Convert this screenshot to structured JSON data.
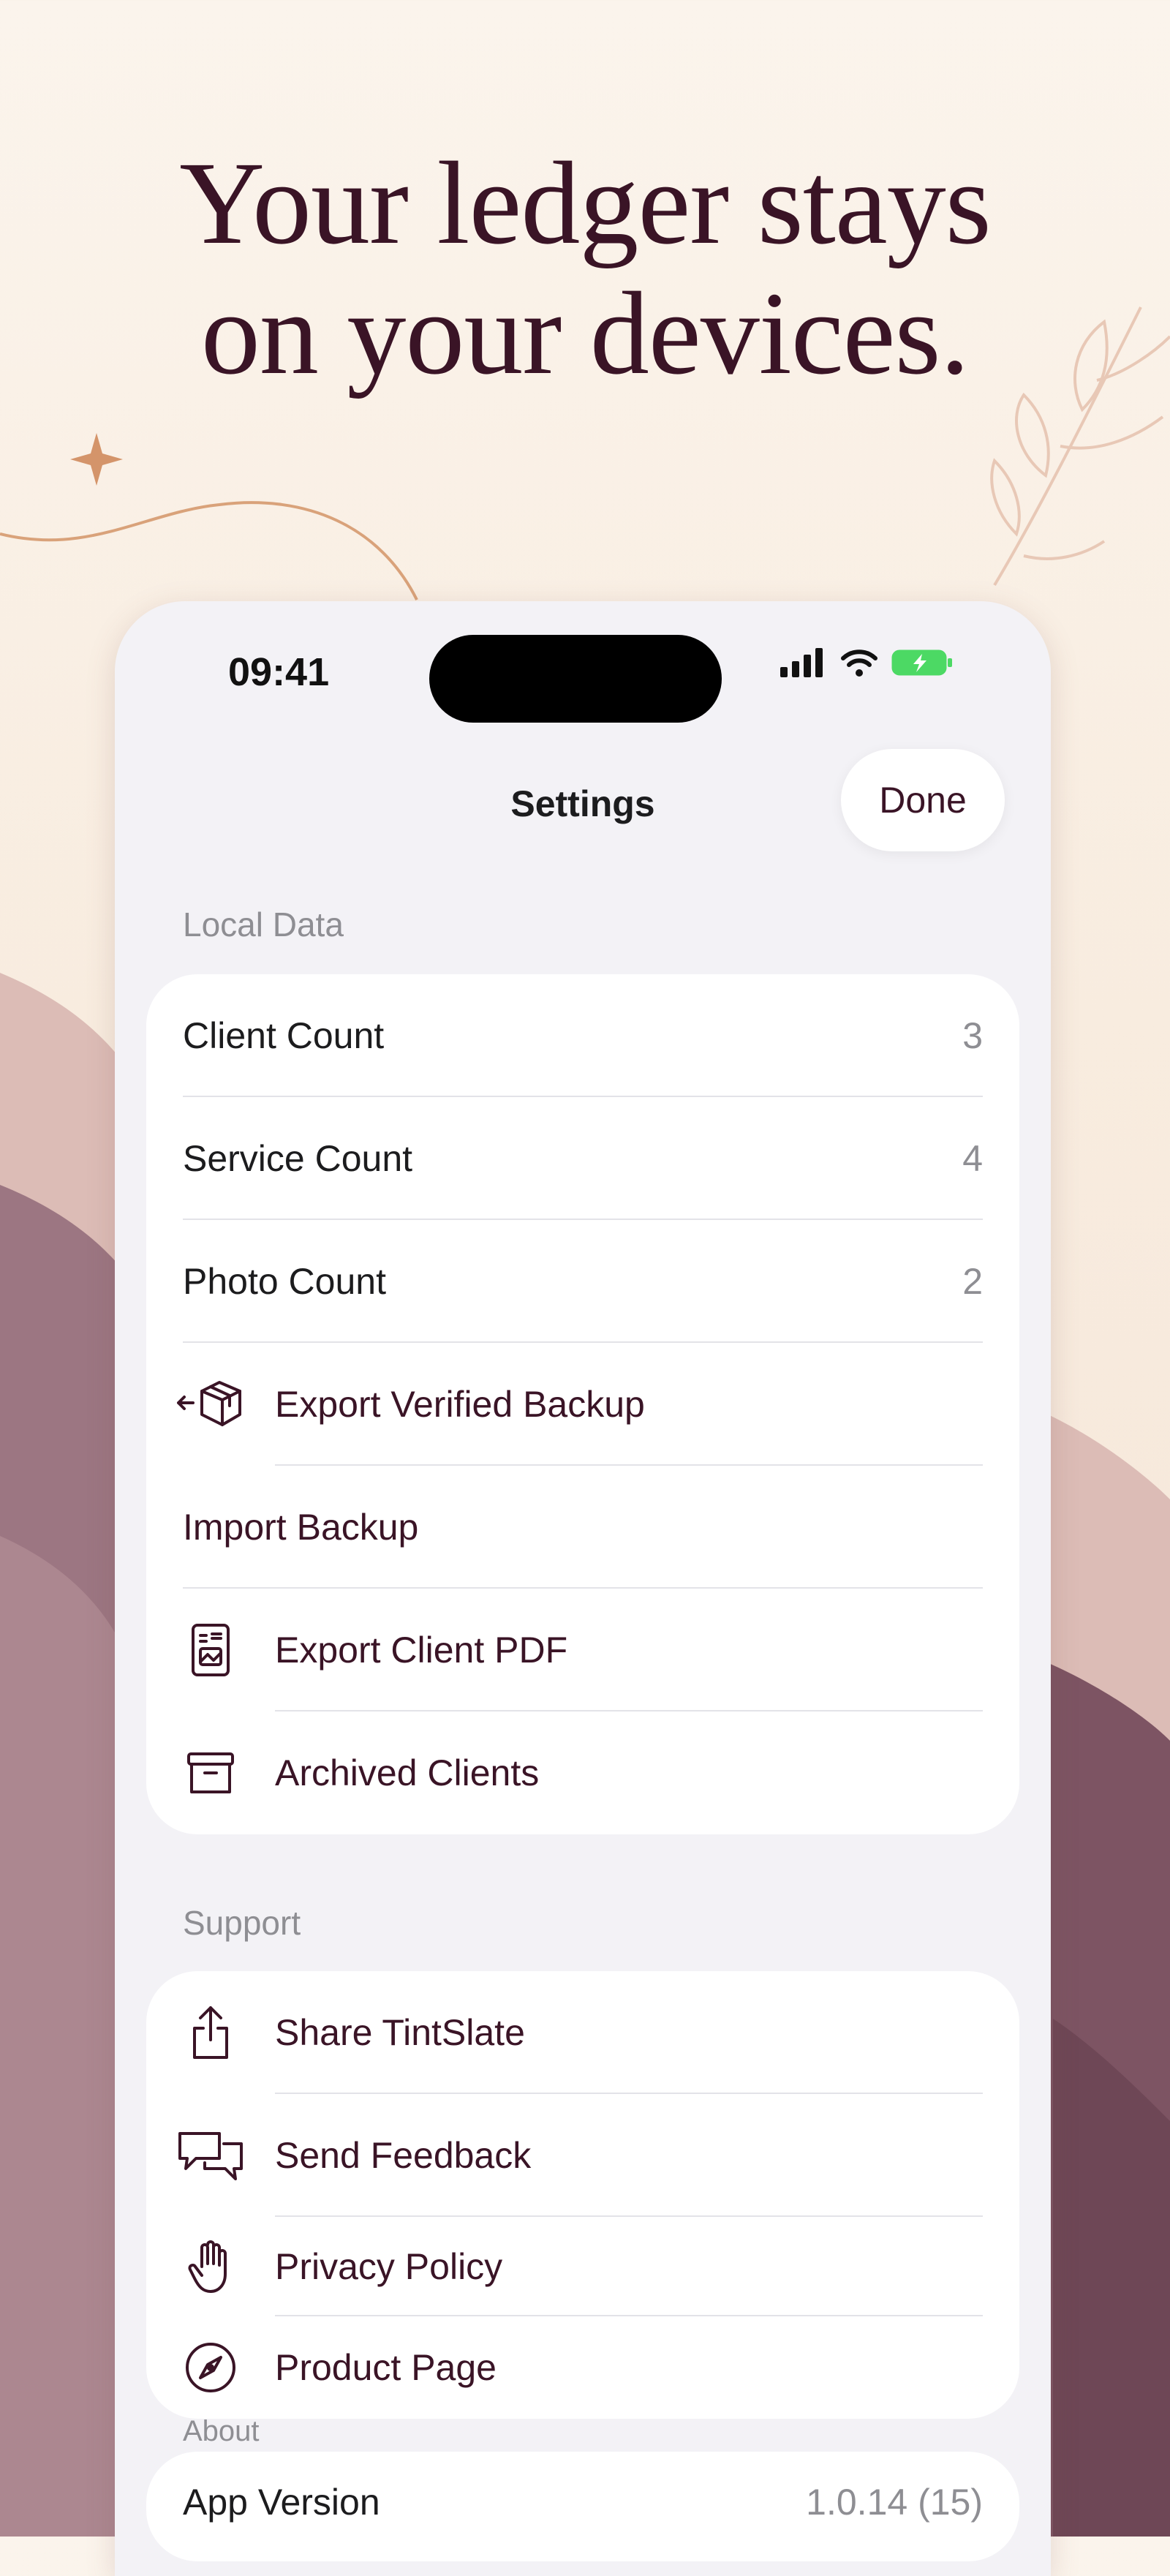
{
  "marketing": {
    "headline_line1": "Your ledger stays",
    "headline_line2": "on your devices."
  },
  "status_bar": {
    "time": "09:41",
    "icons": [
      "cellular-signal-icon",
      "wifi-icon",
      "battery-charging-icon"
    ]
  },
  "nav": {
    "title": "Settings",
    "done_label": "Done"
  },
  "sections": {
    "local_data": {
      "header": "Local Data",
      "client_count_label": "Client Count",
      "client_count_value": "3",
      "service_count_label": "Service Count",
      "service_count_value": "4",
      "photo_count_label": "Photo Count",
      "photo_count_value": "2",
      "export_backup_label": "Export Verified Backup",
      "import_backup_label": "Import Backup",
      "export_pdf_label": "Export Client PDF",
      "archived_label": "Archived Clients"
    },
    "support": {
      "header": "Support",
      "share_label": "Share TintSlate",
      "feedback_label": "Send Feedback",
      "privacy_label": "Privacy Policy",
      "product_label": "Product Page"
    },
    "about": {
      "header": "About",
      "version_label": "App Version",
      "version_value": "1.0.14 (15)"
    }
  },
  "colors": {
    "accent": "#3a1426",
    "background_top": "#fbf4ec",
    "mauve_dark": "#7d5463",
    "mauve_light": "#dcbcb6",
    "gold_line": "#d9a27a",
    "battery_green": "#4cd964"
  }
}
